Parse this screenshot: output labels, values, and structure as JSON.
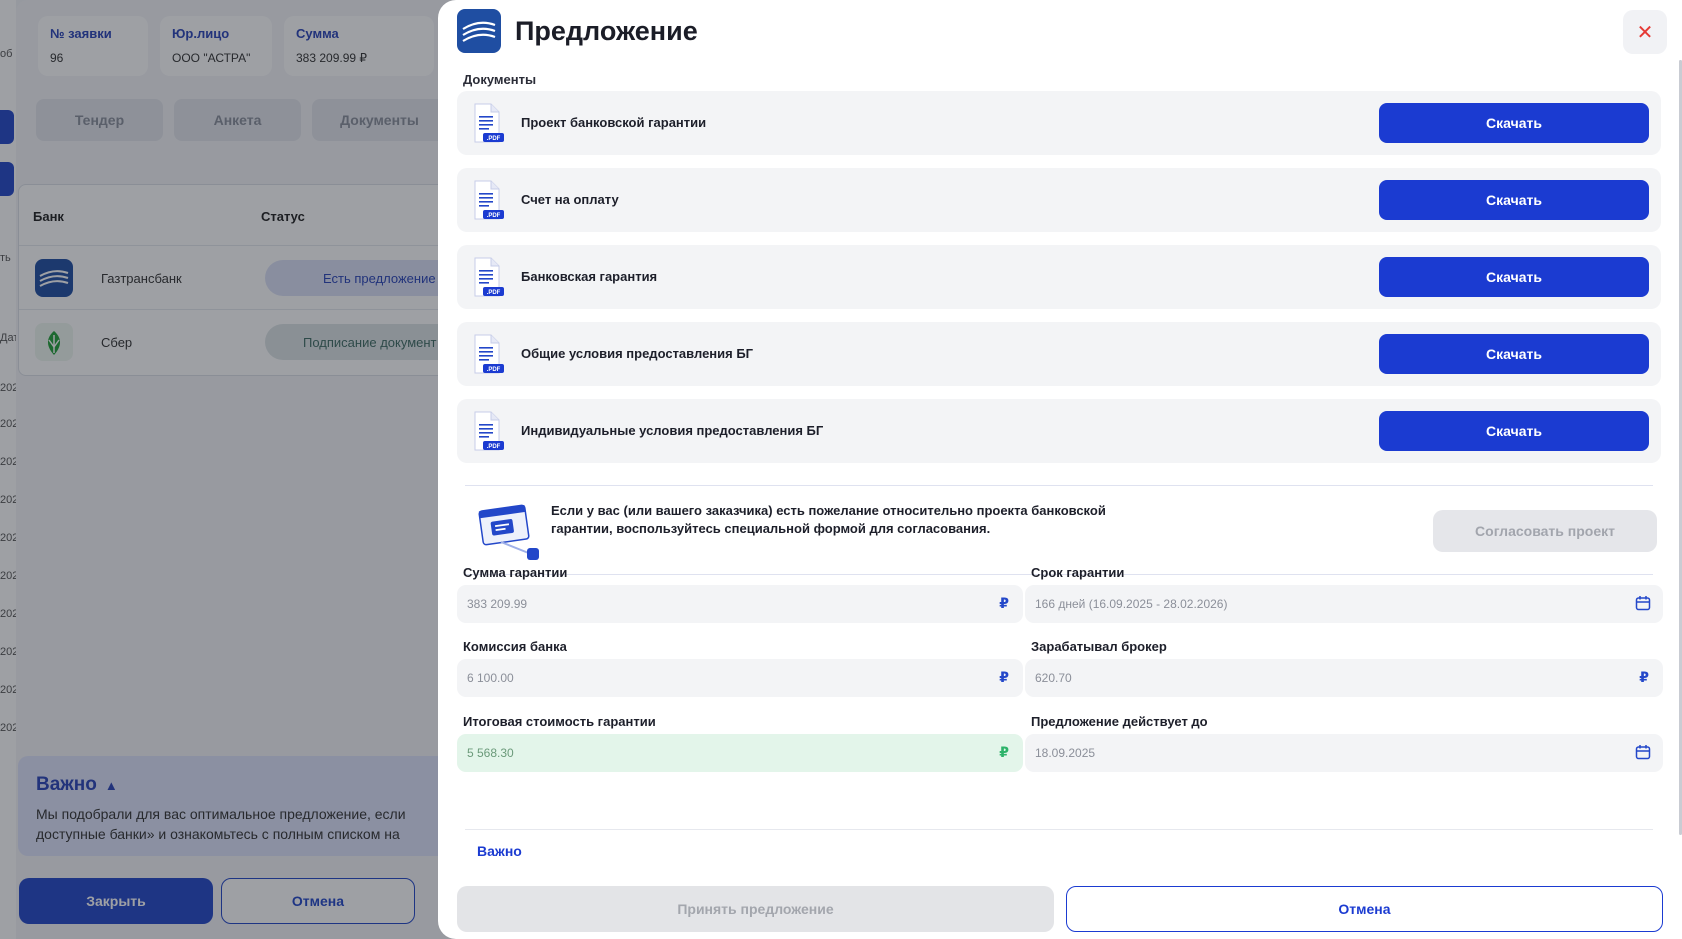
{
  "background": {
    "cards": [
      {
        "label": "№ заявки",
        "value": "96"
      },
      {
        "label": "Юр.лицо",
        "value": "ООО \"АСТРА\""
      },
      {
        "label": "Сумма",
        "value": "383 209.99 ₽"
      }
    ],
    "tabs": [
      "Тендер",
      "Анкета",
      "Документы"
    ],
    "table_headers": {
      "bank": "Банк",
      "status": "Статус"
    },
    "banks": [
      {
        "name": "Газтрансбанк",
        "status": "Есть предложение"
      },
      {
        "name": "Сбер",
        "status": "Подписание документ"
      }
    ],
    "important": {
      "title": "Важно",
      "line1": "Мы подобрали для вас оптимальное предложение, если",
      "line2": "доступные банки» и ознакомьтесь с полным списком на"
    },
    "close_label": "Закрыть",
    "cancel_label": "Отмена",
    "left_fragments": [
      "об",
      "ть",
      "Дат",
      "202",
      "202",
      "202",
      "202",
      "202",
      "202",
      "202",
      "202",
      "202",
      "202"
    ]
  },
  "modal": {
    "title": "Предложение",
    "close_icon": "close-icon",
    "documents_label": "Документы",
    "documents": [
      {
        "name": "Проект банковской гарантии",
        "button": "Скачать"
      },
      {
        "name": "Счет на оплату",
        "button": "Скачать"
      },
      {
        "name": "Банковская гарантия",
        "button": "Скачать"
      },
      {
        "name": "Общие условия предоставления БГ",
        "button": "Скачать"
      },
      {
        "name": "Индивидуальные условия предоставления БГ",
        "button": "Скачать"
      }
    ],
    "file_badge": ".PDF",
    "hint": {
      "text": "Если у вас (или вашего заказчика) есть пожелание относительно проекта банковской гарантии, воспользуйтесь специальной формой для согласования.",
      "button": "Согласовать проект"
    },
    "fields": {
      "guarantee_sum": {
        "label": "Сумма гарантии",
        "value": "383 209.99",
        "suffix": "₽"
      },
      "guarantee_term": {
        "label": "Срок гарантии",
        "value": "166 дней (16.09.2025 - 28.02.2026)"
      },
      "bank_fee": {
        "label": "Комиссия банка",
        "value": "6 100.00",
        "suffix": "₽"
      },
      "broker_earned": {
        "label": "Зарабатывал брокер",
        "value": "620.70",
        "suffix": "₽"
      },
      "total_cost": {
        "label": "Итоговая стоимость гарантии",
        "value": "5 568.30",
        "suffix": "₽"
      },
      "valid_until": {
        "label": "Предложение действует до",
        "value": "18.09.2025"
      }
    },
    "important_label": "Важно",
    "accept_label": "Принять предложение",
    "cancel_label": "Отмена"
  },
  "colors": {
    "primary": "#1b3bd1",
    "danger": "#e53935",
    "success": "#2db36a"
  }
}
